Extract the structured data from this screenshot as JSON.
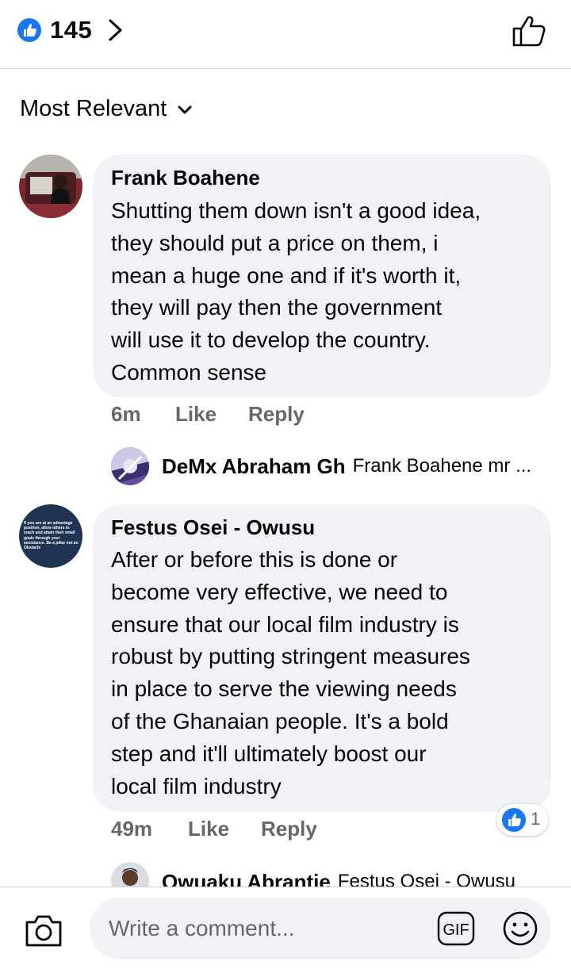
{
  "header": {
    "reaction_count": "145",
    "like_icon": "thumbs-up-icon",
    "chevron_icon": "chevron-right-icon",
    "like_button_icon": "thumbs-up-outline-icon"
  },
  "sort": {
    "label": "Most Relevant",
    "icon": "chevron-down-icon"
  },
  "comments": [
    {
      "author": "Frank Boahene",
      "text_lines": [
        "Shutting them down isn't a good idea,",
        "they should put a price on them, i",
        "mean a huge one and if it's worth it,",
        "they will pay then the government",
        "will use it to develop the country.",
        "Common sense"
      ],
      "time": "6m",
      "like_label": "Like",
      "reply_label": "Reply",
      "reply_preview": {
        "author": "DeMx Abraham Gh",
        "text": "Frank Boahene  mr ..."
      }
    },
    {
      "author": "Festus Osei - Owusu",
      "avatar_text": "If you are at an advantage position, allow others to reach and attain their small goals through your assistance. Be a pillar not an Obstacle",
      "text_lines": [
        "After or before this is done or",
        "become very effective, we need to",
        "ensure that our local film industry is",
        "robust by putting stringent measures",
        "in place to serve the viewing needs",
        "of the Ghanaian people. It's a bold",
        "step and it'll ultimately boost our",
        "local film industry"
      ],
      "time": "49m",
      "like_label": "Like",
      "reply_label": "Reply",
      "reaction_count": "1",
      "reply_preview": {
        "author": "Owuaku Abrantie",
        "text": "Festus Osei - Owusu"
      }
    }
  ],
  "composer": {
    "placeholder": "Write a comment...",
    "camera_icon": "camera-icon",
    "gif_label": "GIF",
    "emoji_icon": "smiley-icon"
  },
  "colors": {
    "brand_blue": "#1877f2",
    "bubble_gray": "#f0f2f5",
    "meta_gray": "#65676b"
  }
}
